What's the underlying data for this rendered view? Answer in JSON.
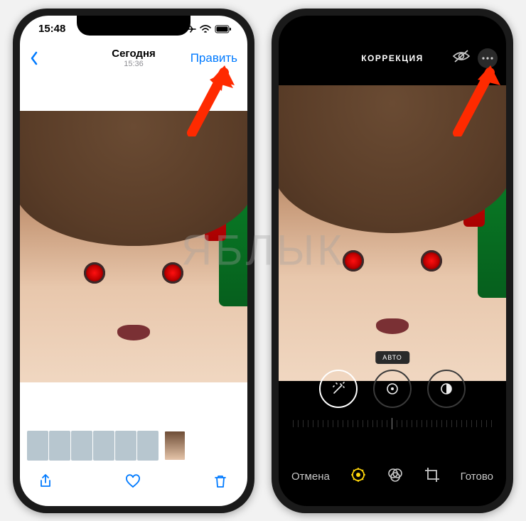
{
  "left": {
    "status": {
      "time": "15:48"
    },
    "nav": {
      "title": "Сегодня",
      "subtitle": "15:36",
      "edit": "Править"
    }
  },
  "right": {
    "header": {
      "title": "КОРРЕКЦИЯ"
    },
    "tool_badge": "АВТО",
    "bottom": {
      "cancel": "Отмена",
      "done": "Готово"
    }
  },
  "watermark": "ЯБЛЫК"
}
